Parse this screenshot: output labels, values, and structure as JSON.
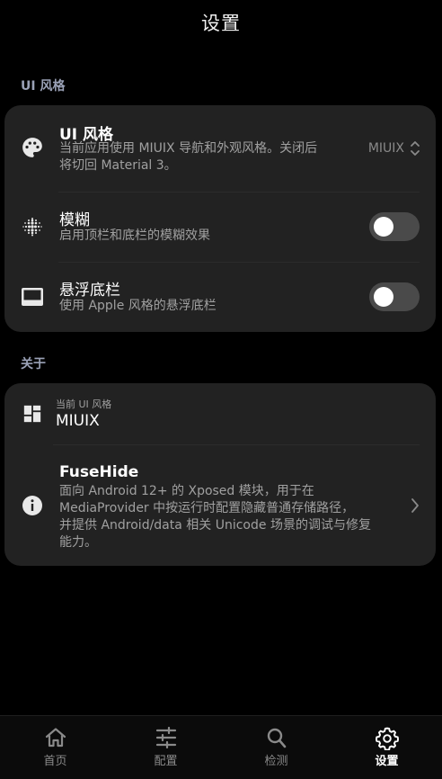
{
  "header": {
    "title": "设置"
  },
  "sections": {
    "ui_style_label": "UI 风格",
    "about_label": "关于"
  },
  "ui_style_card": {
    "style_row": {
      "title": "UI 风格",
      "subtitle_line1": "当前应用使用 MIUIX 导航和外观风格。关闭后",
      "subtitle_line2": "将切回 Material 3。",
      "value": "MIUIX",
      "icon": "palette-icon"
    },
    "blur_row": {
      "title": "模糊",
      "subtitle": "启用顶栏和底栏的模糊效果",
      "icon": "blur-icon",
      "enabled": false
    },
    "floating_bar_row": {
      "title": "悬浮底栏",
      "subtitle": "使用 Apple 风格的悬浮底栏",
      "icon": "bottom-bar-icon",
      "enabled": false
    }
  },
  "about_card": {
    "current_style_row": {
      "caption": "当前 UI 风格",
      "value": "MIUIX",
      "icon": "dashboard-icon"
    },
    "app_row": {
      "title": "FuseHide",
      "desc_line1": "面向 Android 12+ 的 Xposed 模块，用于在",
      "desc_line2": "MediaProvider 中按运行时配置隐藏普通存储路径，",
      "desc_line3": "并提供 Android/data 相关 Unicode 场景的调试与修复",
      "desc_line4": "能力。",
      "icon": "info-icon"
    }
  },
  "bottom_nav": {
    "items": [
      {
        "label": "首页",
        "icon": "home-icon",
        "active": false
      },
      {
        "label": "配置",
        "icon": "sliders-icon",
        "active": false
      },
      {
        "label": "检测",
        "icon": "search-icon",
        "active": false
      },
      {
        "label": "设置",
        "icon": "gear-icon",
        "active": true
      }
    ]
  },
  "colors": {
    "background": "#000000",
    "card": "#222222",
    "section_label": "#9aa1b6",
    "toggle_off": "#4a4a4a"
  }
}
